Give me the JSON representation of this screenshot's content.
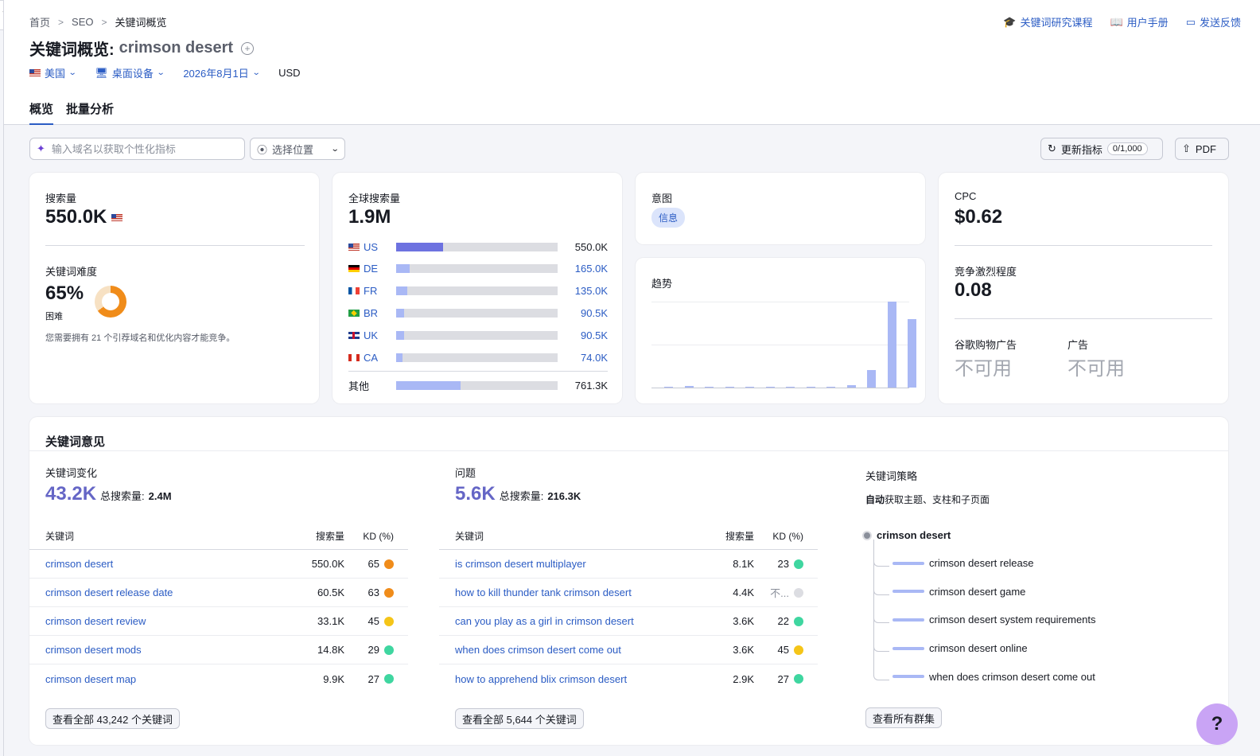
{
  "breadcrumb": [
    "首页",
    "SEO",
    "关键词概览"
  ],
  "top_links": [
    {
      "icon": "graduation-cap-icon",
      "label": "关键词研究课程"
    },
    {
      "icon": "book-icon",
      "label": "用户手册"
    },
    {
      "icon": "comment-icon",
      "label": "发送反馈"
    }
  ],
  "title": {
    "prefix": "关键词概览:",
    "keyword": "crimson desert"
  },
  "filters": {
    "country": "美国",
    "device": "桌面设备",
    "date": "2026年8月1日",
    "currency": "USD"
  },
  "tabs": [
    {
      "label": "概览",
      "active": true
    },
    {
      "label": "批量分析",
      "active": false
    }
  ],
  "toolbar": {
    "domain_placeholder": "输入域名以获取个性化指标",
    "location_placeholder": "选择位置",
    "refresh_label": "更新指标",
    "refresh_count": "0/1,000",
    "pdf_label": "PDF"
  },
  "volume": {
    "label": "搜索量",
    "value": "550.0K"
  },
  "difficulty": {
    "label": "关键词难度",
    "value": "65%",
    "percent": 65,
    "level": "困难",
    "note": "您需要拥有 21 个引荐域名和优化内容才能竞争。"
  },
  "global": {
    "label": "全球搜索量",
    "value": "1.9M",
    "rows": [
      {
        "code": "US",
        "value": "550.0K",
        "share": 0.29
      },
      {
        "code": "DE",
        "value": "165.0K",
        "share": 0.085
      },
      {
        "code": "FR",
        "value": "135.0K",
        "share": 0.07
      },
      {
        "code": "BR",
        "value": "90.5K",
        "share": 0.047
      },
      {
        "code": "UK",
        "value": "90.5K",
        "share": 0.047
      },
      {
        "code": "CA",
        "value": "74.0K",
        "share": 0.038
      }
    ],
    "other": {
      "label": "其他",
      "value": "761.3K",
      "share": 0.4
    }
  },
  "intent": {
    "label": "意图",
    "badge": "信息"
  },
  "trend": {
    "label": "趋势",
    "values": [
      0.01,
      0.015,
      0,
      0.005,
      0.005,
      0.005,
      0.005,
      0.005,
      0.005,
      0.03,
      0.2,
      1.0,
      0.8
    ]
  },
  "cpc": {
    "label": "CPC",
    "value": "$0.62"
  },
  "competition": {
    "label": "竞争激烈程度",
    "value": "0.08"
  },
  "shopping": {
    "label": "谷歌购物广告",
    "value": "不可用"
  },
  "ads": {
    "label": "广告",
    "value": "不可用"
  },
  "ideas": {
    "title": "关键词意见",
    "variations": {
      "label": "关键词变化",
      "count": "43.2K",
      "total_label": "总搜索量:",
      "total": "2.4M",
      "headers": [
        "关键词",
        "搜索量",
        "KD (%)"
      ],
      "rows": [
        {
          "kw": "crimson desert",
          "vol": "550.0K",
          "kd": "65",
          "color": "#f08c1a"
        },
        {
          "kw": "crimson desert release date",
          "vol": "60.5K",
          "kd": "63",
          "color": "#f08c1a"
        },
        {
          "kw": "crimson desert review",
          "vol": "33.1K",
          "kd": "45",
          "color": "#f5c518"
        },
        {
          "kw": "crimson desert mods",
          "vol": "14.8K",
          "kd": "29",
          "color": "#3fd6a0"
        },
        {
          "kw": "crimson desert map",
          "vol": "9.9K",
          "kd": "27",
          "color": "#3fd6a0"
        }
      ],
      "view_all": "查看全部 43,242 个关键词"
    },
    "questions": {
      "label": "问题",
      "count": "5.6K",
      "total_label": "总搜索量:",
      "total": "216.3K",
      "headers": [
        "关键词",
        "搜索量",
        "KD (%)"
      ],
      "rows": [
        {
          "kw": "is crimson desert multiplayer",
          "vol": "8.1K",
          "kd": "23",
          "color": "#3fd6a0"
        },
        {
          "kw": "how to kill thunder tank crimson desert",
          "vol": "4.4K",
          "kd": "不...",
          "color": "#dcdde2"
        },
        {
          "kw": "can you play as a girl in crimson desert",
          "vol": "3.6K",
          "kd": "22",
          "color": "#3fd6a0"
        },
        {
          "kw": "when does crimson desert come out",
          "vol": "3.6K",
          "kd": "45",
          "color": "#f5c518"
        },
        {
          "kw": "how to apprehend blix crimson desert",
          "vol": "2.9K",
          "kd": "27",
          "color": "#3fd6a0"
        }
      ],
      "view_all": "查看全部 5,644 个关键词"
    },
    "strategy": {
      "label": "关键词策略",
      "desc_bold": "自动",
      "desc": "获取主题、支柱和子页面",
      "root": "crimson desert",
      "items": [
        "crimson desert release",
        "crimson desert game",
        "crimson desert system requirements",
        "crimson desert online",
        "when does crimson desert come out"
      ],
      "view_all": "查看所有群集"
    }
  },
  "help": "?"
}
